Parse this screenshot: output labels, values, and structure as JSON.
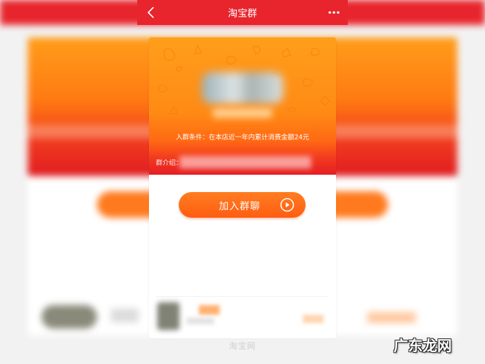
{
  "navbar": {
    "title": "淘宝群",
    "back_icon": "chevron-left-icon",
    "more_icon": "more-horizontal-icon",
    "color": "#e8242c"
  },
  "group_card": {
    "join_condition": "入群条件：在本店近一年内累计消费金额24元",
    "intro_label": "群介绍：",
    "gradient_top": "#ff9e1b",
    "gradient_bottom": "#e41e24"
  },
  "join_button": {
    "label": "加入群聊",
    "icon": "play-circle-icon",
    "color": "#ff6a18"
  },
  "watermarks": {
    "bottom": "淘宝网",
    "corner": "广东龙网"
  }
}
